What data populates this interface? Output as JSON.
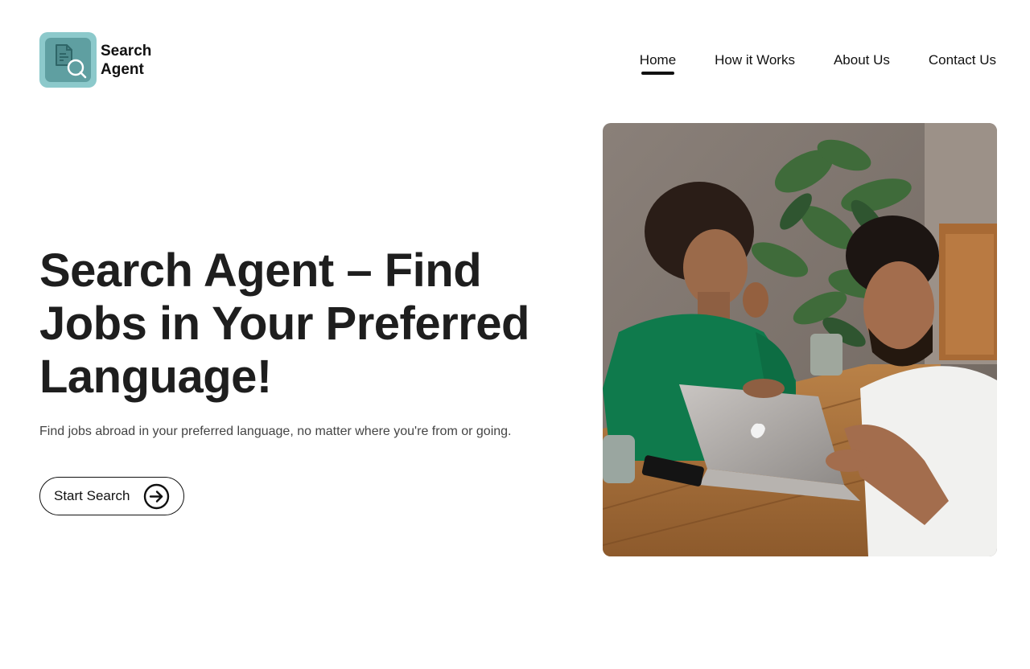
{
  "brand": {
    "name_line1": "Search",
    "name_line2": "Agent",
    "logo_icon": "document-search-icon",
    "logo_color": "#8cc9cb"
  },
  "nav": {
    "items": [
      {
        "label": "Home",
        "active": true
      },
      {
        "label": "How it Works",
        "active": false
      },
      {
        "label": "About Us",
        "active": false
      },
      {
        "label": "Contact Us",
        "active": false
      }
    ]
  },
  "hero": {
    "title": "Search Agent – Find Jobs in Your Preferred Language!",
    "subtitle": "Find jobs abroad in your preferred language, no matter where you're from or going.",
    "cta_label": "Start Search",
    "cta_icon": "arrow-right-circle-icon"
  },
  "photo": {
    "subject": "hero-photo"
  }
}
